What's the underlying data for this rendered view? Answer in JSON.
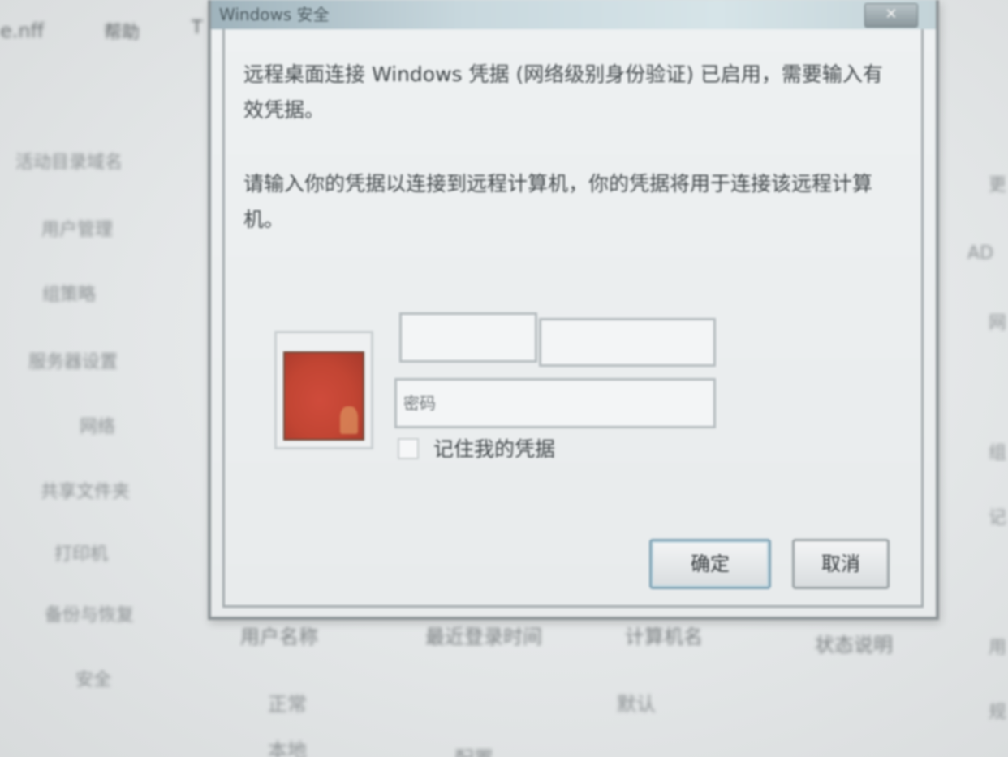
{
  "background": {
    "topbar": {
      "item1": "e.nff",
      "item2": "帮助",
      "item3": "T"
    },
    "sidebar": [
      "活动目录域名",
      "用户管理",
      "组策略",
      "服务器设置",
      "网络",
      "共享文件夹",
      "打印机",
      "备份与恢复",
      "安全"
    ],
    "table_header": [
      "用户名称",
      "最近登录时间",
      "计算机名",
      "状态说明"
    ],
    "table_row": [
      "正常",
      "默认"
    ],
    "table_row2": [
      "本地",
      "配置"
    ],
    "right_edge": [
      "更",
      "AD",
      "网",
      "组",
      "记",
      "用",
      "规"
    ]
  },
  "dialog": {
    "title": "Windows 安全",
    "close_label": "关闭",
    "message_line1": "远程桌面连接 Windows 凭据 (网络级别身份验证) 已启用，需要输入有效凭据。",
    "message_line2": "请输入你的凭据以连接到远程计算机，你的凭据将用于连接该远程计算机。",
    "domain_placeholder": "",
    "username_placeholder": "",
    "password_placeholder": "密码",
    "remember_label": "记住我的凭据",
    "ok_label": "确定",
    "cancel_label": "取消"
  },
  "colors": {
    "titlebar": "#c8d8de",
    "avatar": "#c24533",
    "dialog_bg": "#eef1f2"
  }
}
